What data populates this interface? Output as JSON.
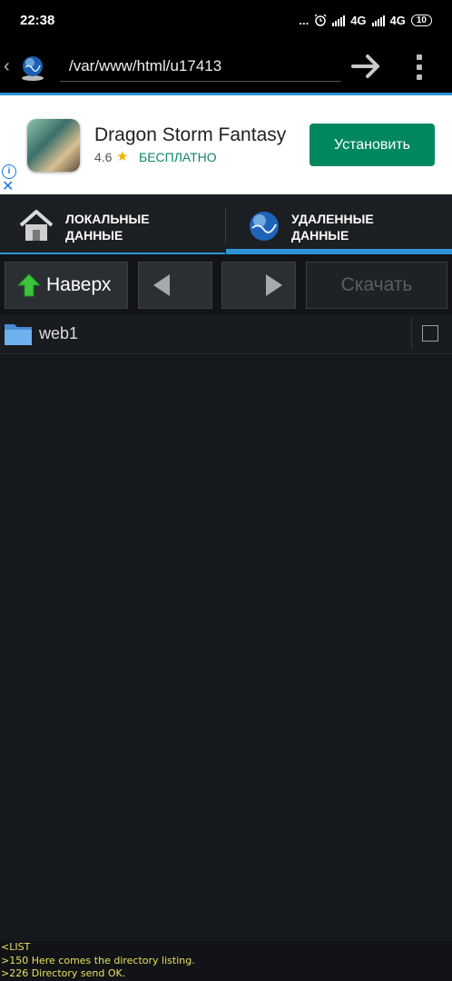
{
  "status_bar": {
    "time": "22:38",
    "dots": "...",
    "network1": "4G",
    "network2": "4G",
    "battery": "10"
  },
  "path_bar": {
    "path": "/var/www/html/u17413"
  },
  "ad": {
    "title": "Dragon Storm Fantasy",
    "rating": "4.6",
    "star": "★",
    "price": "БЕСПЛАТНО",
    "install_label": "Установить",
    "info": "i",
    "close": "✕"
  },
  "tabs": {
    "local": {
      "line1": "ЛОКАЛЬНЫЕ",
      "line2": "ДАННЫЕ"
    },
    "remote": {
      "line1": "УДАЛЕННЫЕ",
      "line2": "ДАННЫЕ"
    }
  },
  "toolbar": {
    "up_label": "Наверх",
    "download_label": "Скачать"
  },
  "files": [
    {
      "name": "web1"
    }
  ],
  "log": [
    "<LIST",
    ">150 Here comes the directory listing.",
    ">226 Directory send OK."
  ],
  "colors": {
    "accent": "#2f95d6",
    "install": "#01875f",
    "log_text": "#e8e060"
  },
  "icons": {
    "back": "chevron-left-icon",
    "server": "globe-icon",
    "go": "arrow-right-icon",
    "menu": "overflow-menu-icon",
    "local": "house-icon",
    "remote": "globe-icon",
    "up": "arrow-up-icon",
    "prev": "triangle-left-icon",
    "next": "triangle-right-icon",
    "folder": "folder-icon"
  }
}
